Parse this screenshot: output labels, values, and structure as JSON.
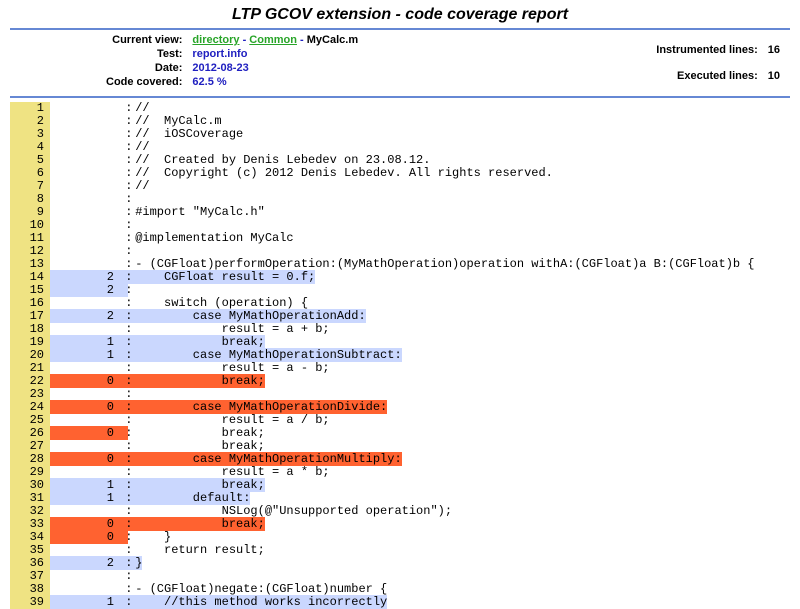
{
  "title": "LTP GCOV extension - code coverage report",
  "header": {
    "labels": {
      "current_view": "Current view:",
      "test": "Test:",
      "date": "Date:",
      "code_covered": "Code covered:",
      "instrumented_lines": "Instrumented lines:",
      "executed_lines": "Executed lines:"
    },
    "breadcrumb": {
      "directory": "directory",
      "common": "Common",
      "current": "MyCalc.m"
    },
    "test": "report.info",
    "date": "2012-08-23",
    "coverage": "62.5 %",
    "instrumented": "16",
    "executed": "10"
  },
  "source": [
    {
      "n": 1,
      "hit": "",
      "code": "//",
      "cls": ""
    },
    {
      "n": 2,
      "hit": "",
      "code": "//  MyCalc.m",
      "cls": ""
    },
    {
      "n": 3,
      "hit": "",
      "code": "//  iOSCoverage",
      "cls": ""
    },
    {
      "n": 4,
      "hit": "",
      "code": "//",
      "cls": ""
    },
    {
      "n": 5,
      "hit": "",
      "code": "//  Created by Denis Lebedev on 23.08.12.",
      "cls": ""
    },
    {
      "n": 6,
      "hit": "",
      "code": "//  Copyright (c) 2012 Denis Lebedev. All rights reserved.",
      "cls": ""
    },
    {
      "n": 7,
      "hit": "",
      "code": "//",
      "cls": ""
    },
    {
      "n": 8,
      "hit": "",
      "code": "",
      "cls": ""
    },
    {
      "n": 9,
      "hit": "",
      "code": "#import \"MyCalc.h\"",
      "cls": ""
    },
    {
      "n": 10,
      "hit": "",
      "code": "",
      "cls": ""
    },
    {
      "n": 11,
      "hit": "",
      "code": "@implementation MyCalc",
      "cls": ""
    },
    {
      "n": 12,
      "hit": "",
      "code": "",
      "cls": ""
    },
    {
      "n": 13,
      "hit": "",
      "code": "- (CGFloat)performOperation:(MyMathOperation)operation withA:(CGFloat)a B:(CGFloat)b {",
      "cls": ""
    },
    {
      "n": 14,
      "hit": "2",
      "code": "    CGFloat result = 0.f;",
      "cls": "bg-cov"
    },
    {
      "n": 15,
      "hit": "2",
      "code": "",
      "cls": "bg-cov",
      "hitOnly": true
    },
    {
      "n": 16,
      "hit": "",
      "code": "    switch (operation) {",
      "cls": ""
    },
    {
      "n": 17,
      "hit": "2",
      "code": "        case MyMathOperationAdd:",
      "cls": "bg-cov"
    },
    {
      "n": 18,
      "hit": "",
      "code": "            result = a + b;",
      "cls": ""
    },
    {
      "n": 19,
      "hit": "1",
      "code": "            break;",
      "cls": "bg-cov"
    },
    {
      "n": 20,
      "hit": "1",
      "code": "        case MyMathOperationSubtract:",
      "cls": "bg-cov"
    },
    {
      "n": 21,
      "hit": "",
      "code": "            result = a - b;",
      "cls": ""
    },
    {
      "n": 22,
      "hit": "0",
      "code": "            break;",
      "cls": "bg-uncov",
      "sp": 12
    },
    {
      "n": 23,
      "hit": "",
      "code": "",
      "cls": ""
    },
    {
      "n": 24,
      "hit": "0",
      "code": "        case MyMathOperationDivide:",
      "cls": "bg-uncov",
      "sp": 8
    },
    {
      "n": 25,
      "hit": "",
      "code": "            result = a / b;",
      "cls": ""
    },
    {
      "n": 26,
      "hit": "0",
      "code": "            break;",
      "cls": "bg-uncov",
      "sp": 12,
      "hitOnly": true
    },
    {
      "n": 27,
      "hit": "",
      "code": "            break;",
      "cls": ""
    },
    {
      "n": 28,
      "hit": "0",
      "code": "        case MyMathOperationMultiply:",
      "cls": "bg-uncov",
      "sp": 8
    },
    {
      "n": 29,
      "hit": "",
      "code": "            result = a * b;",
      "cls": ""
    },
    {
      "n": 30,
      "hit": "1",
      "code": "            break;",
      "cls": "bg-cov"
    },
    {
      "n": 31,
      "hit": "1",
      "code": "        default:",
      "cls": "bg-cov"
    },
    {
      "n": 32,
      "hit": "",
      "code": "            NSLog(@\"Unsupported operation\");",
      "cls": ""
    },
    {
      "n": 33,
      "hit": "0",
      "code": "            break;",
      "cls": "bg-uncov",
      "sp": 12
    },
    {
      "n": 34,
      "hit": "0",
      "code": "    }",
      "cls": "bg-uncov",
      "sp": 4,
      "hitOnly": true
    },
    {
      "n": 35,
      "hit": "",
      "code": "    return result;",
      "cls": ""
    },
    {
      "n": 36,
      "hit": "2",
      "code": "}",
      "cls": "bg-cov"
    },
    {
      "n": 37,
      "hit": "",
      "code": "",
      "cls": ""
    },
    {
      "n": 38,
      "hit": "",
      "code": "- (CGFloat)negate:(CGFloat)number {",
      "cls": ""
    },
    {
      "n": 39,
      "hit": "1",
      "code": "    //this method works incorrectly",
      "cls": "bg-cov"
    }
  ]
}
